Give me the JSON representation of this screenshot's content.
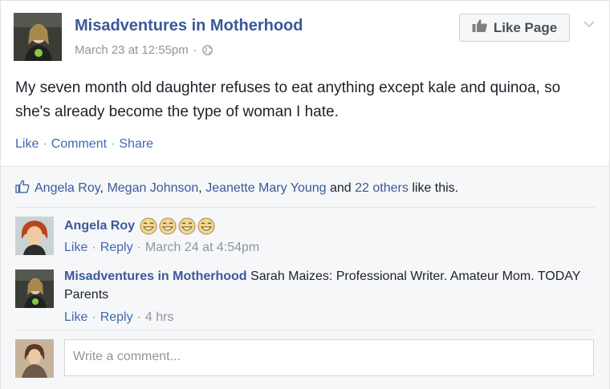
{
  "post": {
    "page_name": "Misadventures in Motherhood",
    "date": "March 23 at 12:55pm",
    "meta_separator": "·",
    "like_page_label": "Like Page",
    "text": "My seven month old daughter refuses to eat anything except kale and quinoa, so she's already become the type of woman I hate.",
    "actions": {
      "like": "Like",
      "comment": "Comment",
      "share": "Share",
      "separator": "·"
    }
  },
  "likes": {
    "names": [
      "Angela Roy",
      "Megan Johnson",
      "Jeanette Mary Young"
    ],
    "comma": ",",
    "and": "and",
    "others": "22 others",
    "suffix": "like this."
  },
  "comments": [
    {
      "author": "Angela Roy",
      "text": "",
      "emoji_count": 4,
      "like": "Like",
      "reply": "Reply",
      "time": "March 24 at 4:54pm"
    },
    {
      "author": "Misadventures in Motherhood",
      "text": "Sarah Maizes: Professional Writer. Amateur Mom. TODAY Parents",
      "like": "Like",
      "reply": "Reply",
      "time": "4 hrs"
    }
  ],
  "composer": {
    "placeholder": "Write a comment..."
  },
  "colors": {
    "link": "#3b5998",
    "action": "#4267b2",
    "meta": "#90949c",
    "ufi_bg": "#f6f7f9"
  },
  "icons": [
    "globe-icon",
    "thumbs-up-icon",
    "chevron-down-icon",
    "like-outline-icon",
    "laughing-emoji-icon"
  ]
}
